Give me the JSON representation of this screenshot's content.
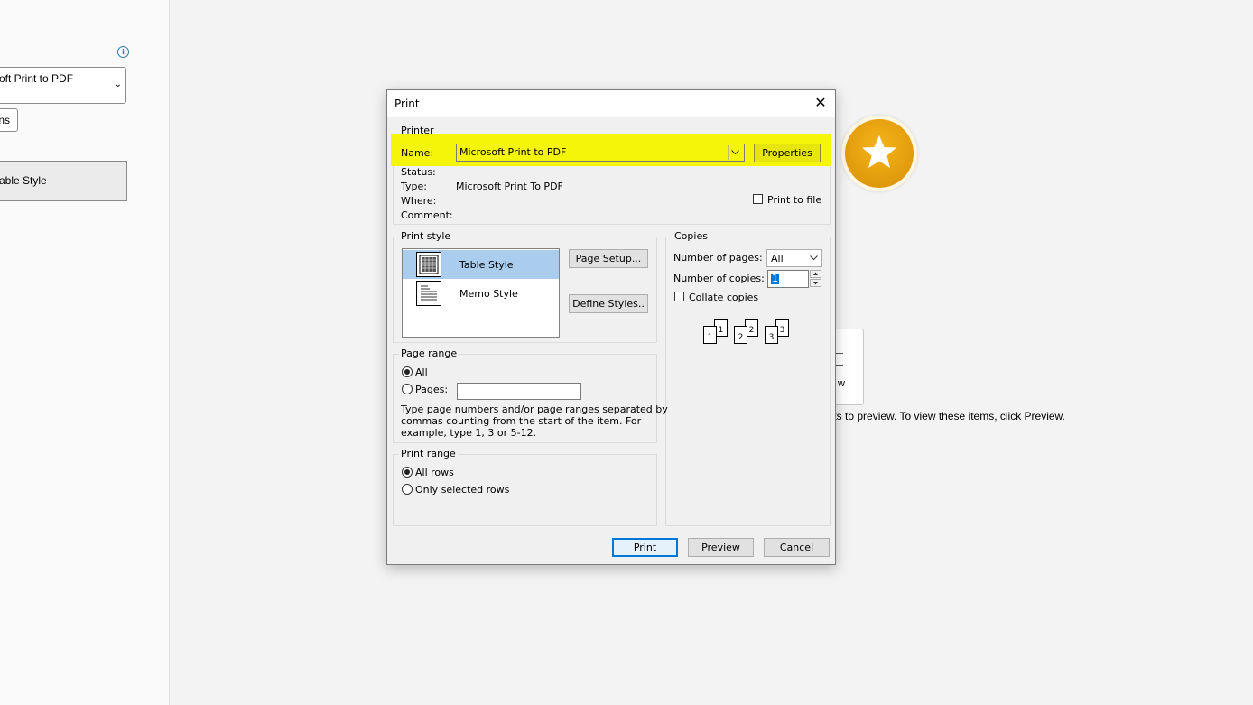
{
  "background": {
    "printer_value": "oft Print to PDF",
    "options_label": "ns",
    "style_item": "able Style",
    "info_glyph": "i",
    "preview_tile_label": "w",
    "preview_hint": "ments to preview. To view these items, click Preview."
  },
  "dialog": {
    "title": "Print",
    "close_glyph": "✕",
    "printer": {
      "group_label": "Printer",
      "name_label": "Name:",
      "name_value": "Microsoft Print to PDF",
      "properties_label": "Properties",
      "status_label": "Status:",
      "type_label": "Type:",
      "type_value": "Microsoft Print To PDF",
      "where_label": "Where:",
      "comment_label": "Comment:",
      "print_to_file_label": "Print to file"
    },
    "print_style": {
      "group_label": "Print style",
      "items": [
        {
          "label": "Table Style",
          "selected": true
        },
        {
          "label": "Memo Style",
          "selected": false
        }
      ],
      "page_setup_label": "Page Setup...",
      "define_styles_label": "Define Styles.."
    },
    "copies": {
      "group_label": "Copies",
      "num_pages_label": "Number of pages:",
      "num_pages_value": "All",
      "num_copies_label": "Number of copies:",
      "num_copies_value": "1",
      "collate_label": "Collate copies",
      "collate_pages": [
        "1",
        "1",
        "2",
        "2",
        "3",
        "3"
      ]
    },
    "page_range": {
      "group_label": "Page range",
      "all_label": "All",
      "pages_label": "Pages:",
      "pages_value": "",
      "help_text_1": "Type page numbers and/or page ranges separated by",
      "help_text_2": "commas counting from the start of the item.  For",
      "help_text_3": "example, type 1, 3 or 5-12."
    },
    "print_range": {
      "group_label": "Print range",
      "all_rows_label": "All rows",
      "selected_rows_label": "Only selected rows"
    },
    "buttons": {
      "print_label": "Print",
      "preview_label": "Preview",
      "cancel_label": "Cancel"
    }
  },
  "colors": {
    "highlight": "#f5f50a",
    "badge": "#e09a0c",
    "selection": "#aacdee",
    "accent": "#0078d7"
  }
}
